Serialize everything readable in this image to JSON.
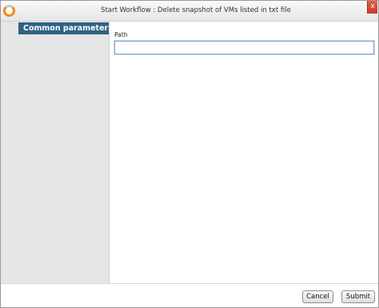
{
  "window": {
    "title": "Start Workflow : Delete snapshot of VMs listed in txt file",
    "close_glyph": "x",
    "app_icon": "vco-orchestrator-icon",
    "close_icon": "close-icon"
  },
  "sidebar": {
    "items": [
      {
        "label": "Common parameters",
        "selected": true
      }
    ]
  },
  "form": {
    "fields": [
      {
        "label": "Path",
        "value": "",
        "placeholder": ""
      }
    ]
  },
  "footer": {
    "cancel_label": "Cancel",
    "submit_label": "Submit"
  },
  "colors": {
    "sidebar_bg": "#e6e6e6",
    "selected_item_bg": "#2f6285",
    "icon_accent": "#f08a12"
  }
}
